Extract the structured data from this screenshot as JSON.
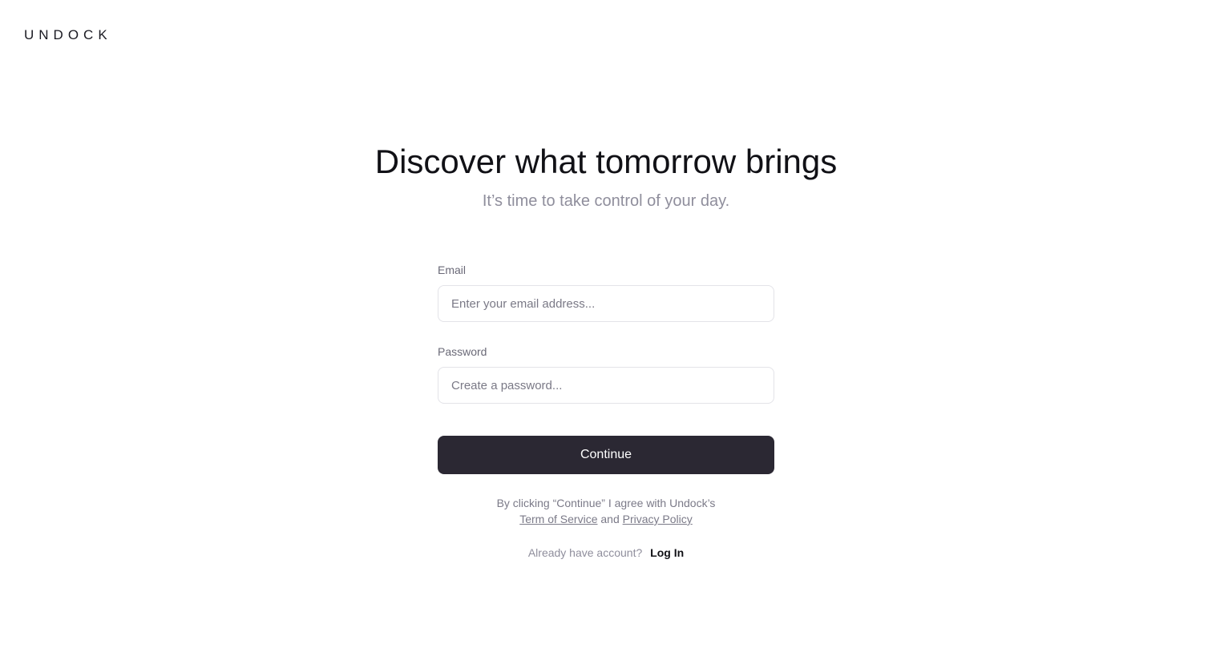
{
  "header": {
    "logo_text": "UNDOCK"
  },
  "hero": {
    "title": "Discover what tomorrow brings",
    "subtitle": "It’s time to take control of your day."
  },
  "form": {
    "email": {
      "label": "Email",
      "placeholder": "Enter your email address...",
      "value": ""
    },
    "password": {
      "label": "Password",
      "placeholder": "Create a password...",
      "value": ""
    },
    "continue_label": "Continue"
  },
  "terms": {
    "prefix": "By clicking “Continue” I agree with Undock’s",
    "tos_link": "Term of Service",
    "and": "and",
    "privacy_link": "Privacy Policy"
  },
  "login": {
    "prompt": "Already have account?",
    "link": "Log In"
  },
  "colors": {
    "button_bg": "#2b2833",
    "title": "#111116",
    "muted": "#8f8e9c"
  }
}
